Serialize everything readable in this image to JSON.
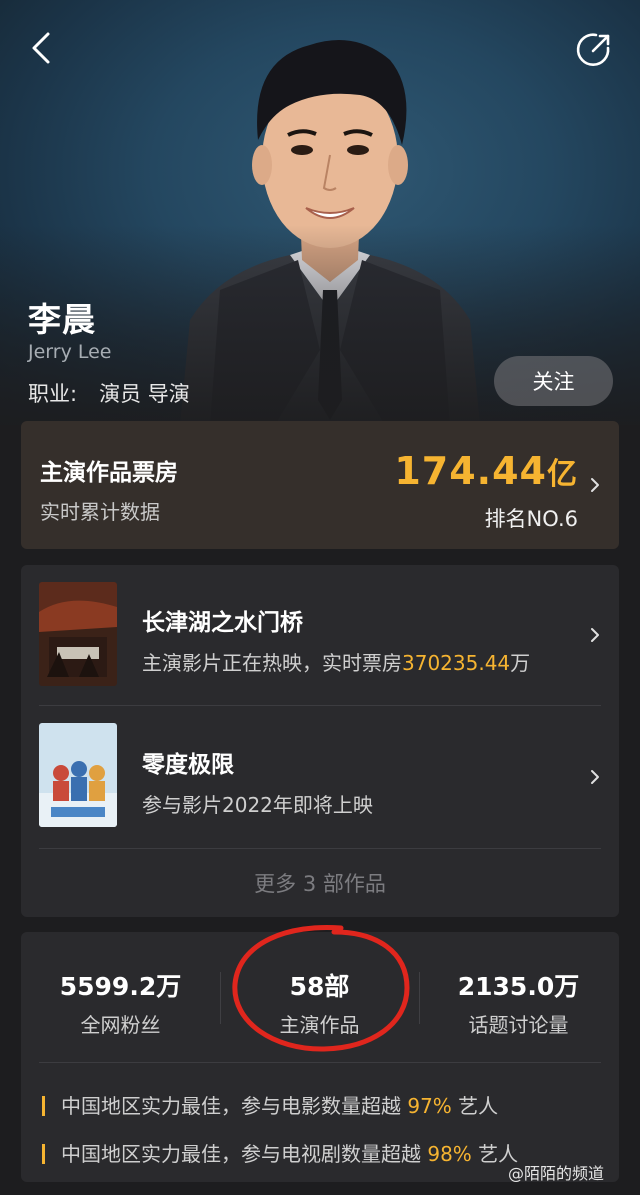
{
  "header": {
    "back_icon": "chevron-left-icon",
    "share_icon": "share-icon"
  },
  "profile": {
    "name": "李晨",
    "english_name": "Jerry Lee",
    "occupation_label": "职业:",
    "occupation_value": "演员 导演",
    "follow_label": "关注"
  },
  "box_office": {
    "title": "主演作品票房",
    "subtitle": "实时累计数据",
    "amount": "174.44",
    "unit": "亿",
    "rank": "排名NO.6",
    "accent_color": "#f6b431"
  },
  "movies": [
    {
      "title": "长津湖之水门桥",
      "desc_prefix": "主演影片正在热映，实时票房",
      "desc_highlight": "370235.44",
      "desc_suffix": "万"
    },
    {
      "title": "零度极限",
      "desc_prefix": "参与影片2022年即将上映",
      "desc_highlight": "",
      "desc_suffix": ""
    }
  ],
  "more_works": "更多 3 部作品",
  "stats": [
    {
      "value": "5599.2万",
      "label": "全网粉丝"
    },
    {
      "value": "58部",
      "label": "主演作品"
    },
    {
      "value": "2135.0万",
      "label": "话题讨论量"
    }
  ],
  "facts": [
    {
      "text": "中国地区实力最佳，参与电影数量超越",
      "pct": "97%",
      "suffix": "艺人"
    },
    {
      "text": "中国地区实力最佳，参与电视剧数量超越",
      "pct": "98%",
      "suffix": "艺人"
    }
  ],
  "watermark": "@陌陌的频道"
}
